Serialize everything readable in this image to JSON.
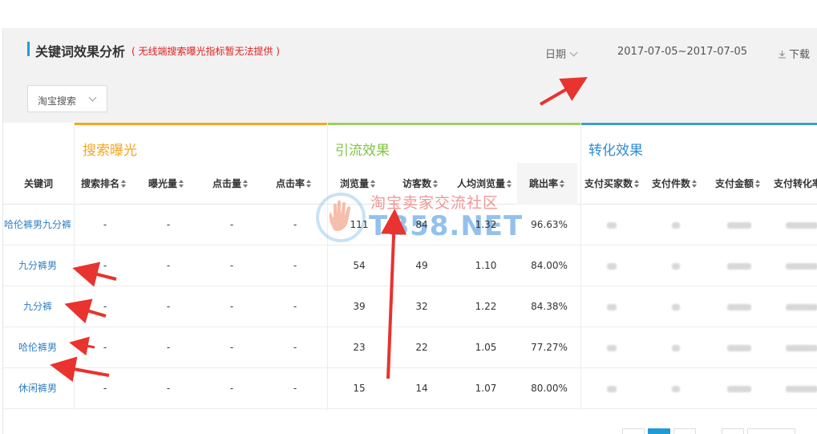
{
  "header": {
    "title": "关键词效果分析",
    "note": "( 无线端搜索曝光指标暂无法提供 )",
    "date_label": "日期",
    "date_range": "2017-07-05~2017-07-05",
    "download_label": "下载"
  },
  "filter": {
    "source_value": "淘宝搜索"
  },
  "groups": {
    "search": "搜索曝光",
    "traffic": "引流效果",
    "convert": "转化效果"
  },
  "columns": {
    "keyword": "关键词",
    "rank": "搜索排名",
    "impressions": "曝光量",
    "clicks": "点击量",
    "ctr": "点击率",
    "pageviews": "浏览量",
    "visitors": "访客数",
    "pv_per_visitor": "人均浏览量",
    "bounce": "跳出率",
    "buyers": "支付买家数",
    "items": "支付件数",
    "amount": "支付金额",
    "conversion": "支付转化率"
  },
  "rows": [
    {
      "keyword": "哈伦裤男九分裤",
      "rank": "-",
      "impressions": "-",
      "clicks": "-",
      "ctr": "-",
      "pageviews": "111",
      "visitors": "84",
      "pv_per_visitor": "1.32",
      "bounce": "96.63%"
    },
    {
      "keyword": "九分裤男",
      "rank": "-",
      "impressions": "-",
      "clicks": "-",
      "ctr": "-",
      "pageviews": "54",
      "visitors": "49",
      "pv_per_visitor": "1.10",
      "bounce": "84.00%"
    },
    {
      "keyword": "九分裤",
      "rank": "-",
      "impressions": "-",
      "clicks": "-",
      "ctr": "-",
      "pageviews": "39",
      "visitors": "32",
      "pv_per_visitor": "1.22",
      "bounce": "84.38%"
    },
    {
      "keyword": "哈伦裤男",
      "rank": "-",
      "impressions": "-",
      "clicks": "-",
      "ctr": "-",
      "pageviews": "23",
      "visitors": "22",
      "pv_per_visitor": "1.05",
      "bounce": "77.27%"
    },
    {
      "keyword": "休闲裤男",
      "rank": "-",
      "impressions": "-",
      "clicks": "-",
      "ctr": "-",
      "pageviews": "15",
      "visitors": "14",
      "pv_per_visitor": "1.07",
      "bounce": "80.00%"
    }
  ],
  "watermark": {
    "line1": "淘宝卖家交流社区",
    "line2": "TB58.NET"
  },
  "colors": {
    "accent": "#1f9bd6",
    "search_group": "#f5a623",
    "traffic_group": "#82c341",
    "convert_group": "#2d8cd4",
    "annotation_arrow": "#e8332e"
  }
}
